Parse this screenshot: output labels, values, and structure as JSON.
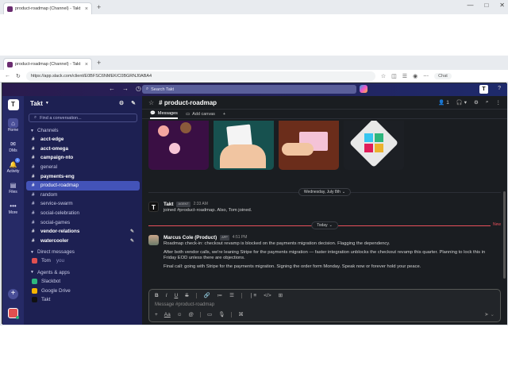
{
  "browser": {
    "tab_title": "product-roadmap (Channel) - Takt",
    "tab_close": "×",
    "new_tab": "+",
    "url": "https://app.slack.com/client/E0BFSC6NMEK/C0BGRNJ0ABA4",
    "copilot_label": "Chat",
    "window_controls": [
      "—",
      "□",
      "✕"
    ]
  },
  "topbar": {
    "search_placeholder": "Search Takt",
    "workspace_initial": "T",
    "help": "?"
  },
  "rail": {
    "workspace_initial": "T",
    "items": [
      {
        "label": "Home",
        "icon": "⌂"
      },
      {
        "label": "DMs",
        "icon": "✉"
      },
      {
        "label": "Activity",
        "icon": "🔔",
        "badge": "1"
      },
      {
        "label": "Files",
        "icon": "▤"
      },
      {
        "label": "More",
        "icon": "•••"
      }
    ],
    "add": "+"
  },
  "sidebar": {
    "workspace_name": "Takt",
    "find_placeholder": "Find a conversation...",
    "channels_header": "Channels",
    "channels": [
      {
        "name": "acct-edge",
        "bold": true
      },
      {
        "name": "acct-omega",
        "bold": true
      },
      {
        "name": "campaign-nto",
        "bold": true
      },
      {
        "name": "general",
        "bold": false
      },
      {
        "name": "payments-eng",
        "bold": true
      },
      {
        "name": "product-roadmap",
        "bold": false,
        "active": true
      },
      {
        "name": "random",
        "bold": false
      },
      {
        "name": "service-swarm",
        "bold": false
      },
      {
        "name": "social-celebration",
        "bold": false
      },
      {
        "name": "social-games",
        "bold": false
      },
      {
        "name": "vendor-relations",
        "bold": true
      },
      {
        "name": "watercooler",
        "bold": true
      }
    ],
    "dm_header": "Direct messages",
    "dms": [
      {
        "name": "Tom",
        "suffix": "you"
      }
    ],
    "apps_header": "Agents & apps",
    "apps": [
      {
        "name": "Slackbot",
        "color": "#2eb67d"
      },
      {
        "name": "Google Drive",
        "color": "#f4b400"
      },
      {
        "name": "Takt",
        "color": "#111111"
      }
    ]
  },
  "channel": {
    "name": "# product-roadmap",
    "members": "1",
    "tabs": [
      "Messages",
      "Add canvas"
    ],
    "add_tab": "+"
  },
  "dividers": {
    "date1": "Wednesday, July 8th",
    "date2": "Today",
    "new_label": "New"
  },
  "messages": [
    {
      "author": "Takt",
      "tag": "AGENT",
      "time": "2:33 AM",
      "paragraphs": [
        "joined #product-roadmap. Also, Tom joined."
      ]
    },
    {
      "author": "Marcus Cole (Product)",
      "tag": "APP",
      "time": "4:51 PM",
      "paragraphs": [
        "Roadmap check-in: checkout revamp is blocked on the payments migration decision. Flagging the dependency.",
        "After both vendor calls, we're leaning Stripe for the payments migration — faster integration unblocks the checkout revamp this quarter. Planning to lock this in Friday EOD unless there are objections.",
        "Final call: going with Stripe for the payments migration. Signing the order form Monday. Speak now or forever hold your peace."
      ]
    }
  ],
  "composer": {
    "placeholder": "Message #product-roadmap"
  },
  "colors": {
    "accent": "#4353b8",
    "sidebar": "#1d2052",
    "rail": "#262a66",
    "new_line": "#e8505b"
  }
}
